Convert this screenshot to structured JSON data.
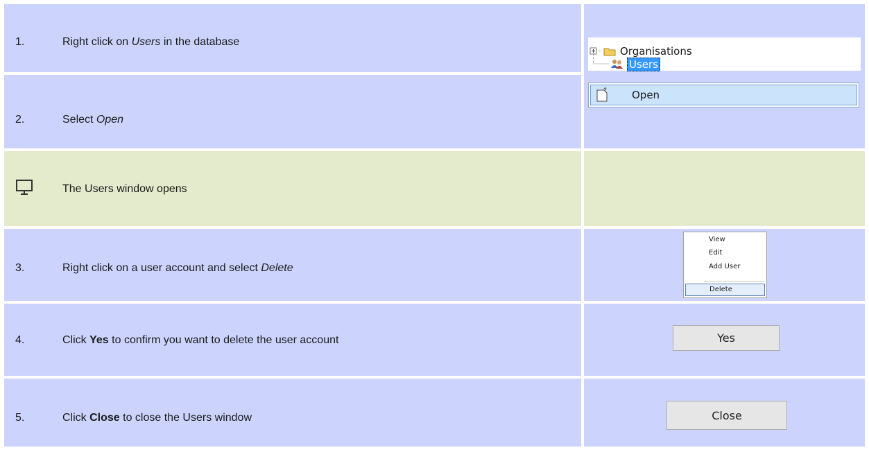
{
  "steps": [
    {
      "num": "1.",
      "pre": "Right click on ",
      "em": "Users",
      "post": " in the database"
    },
    {
      "num": "2.",
      "pre": "Select ",
      "em": "Open",
      "post": ""
    },
    {
      "text": "The Users window opens",
      "icon": "monitor-icon"
    },
    {
      "num": "3.",
      "pre": "Right click on a user account and select ",
      "em": "Delete",
      "post": ""
    },
    {
      "num": "4.",
      "pre": "Click ",
      "strong": "Yes",
      "post": " to confirm you want to delete the user account"
    },
    {
      "num": "5.",
      "pre": "Click ",
      "strong": "Close",
      "post": " to close the Users window"
    }
  ],
  "tree": {
    "organisations": "Organisations",
    "users": "Users"
  },
  "open_menu": {
    "label": "Open"
  },
  "context_menu": {
    "items": [
      "View",
      "Edit",
      "Add User"
    ],
    "selected": "Delete"
  },
  "buttons": {
    "yes": "Yes",
    "close": "Close"
  },
  "colors": {
    "step_bg": "#ccd4fe",
    "result_bg": "#e3ebcc",
    "highlight": "#cce4fb"
  }
}
